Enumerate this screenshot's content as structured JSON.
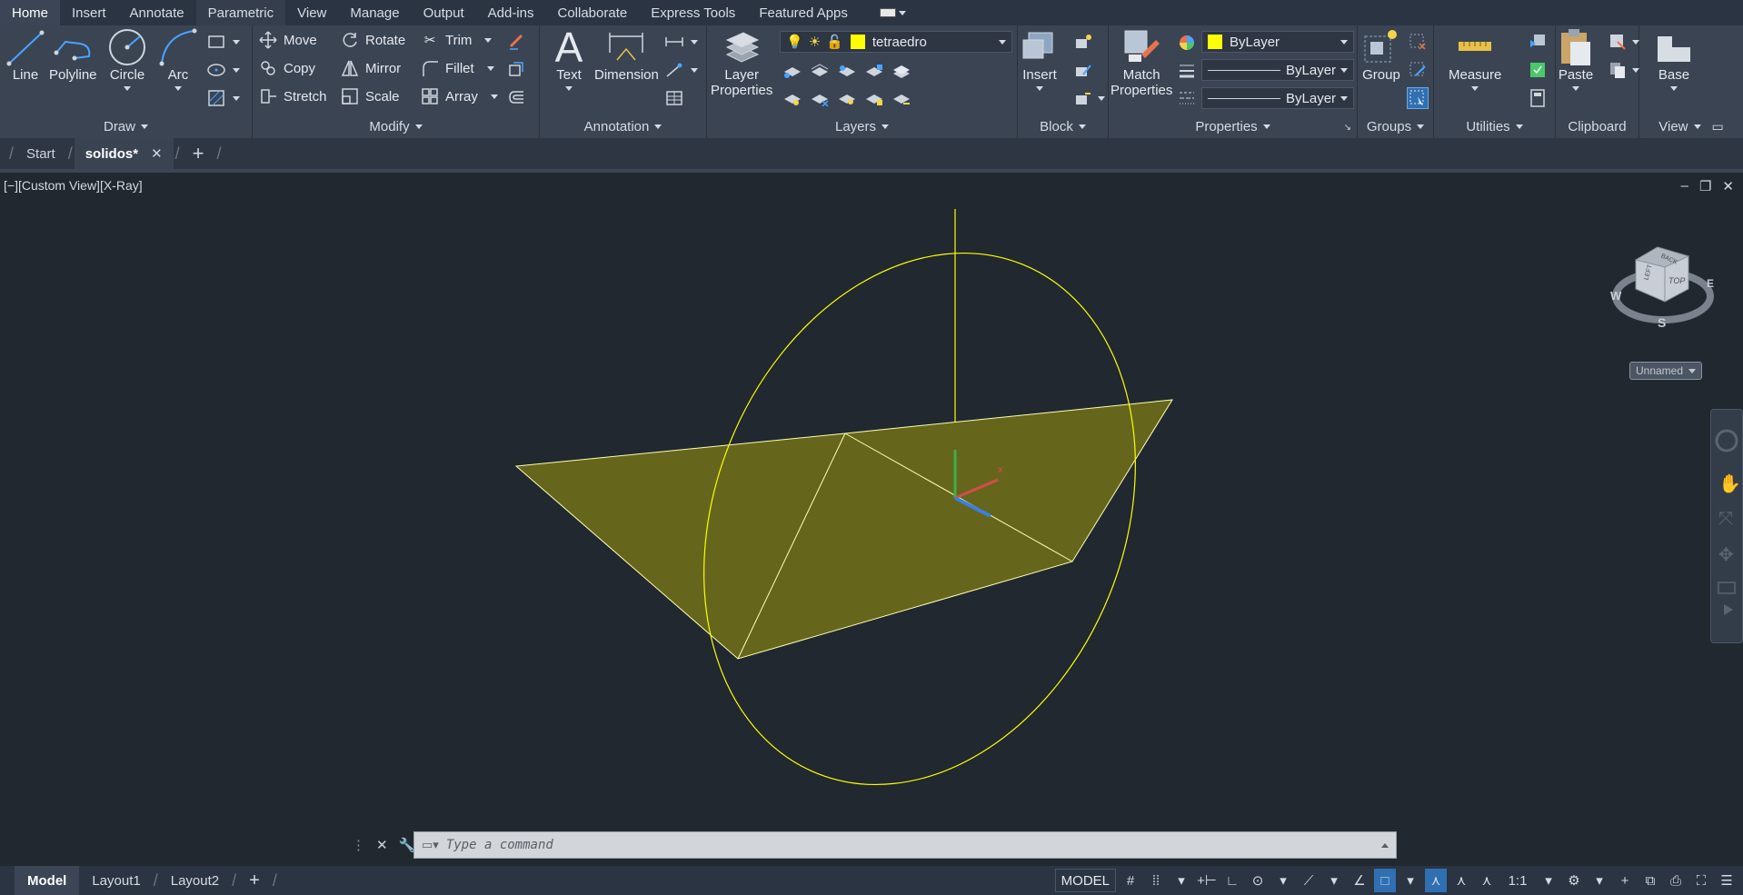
{
  "ribbon_tabs": [
    "Home",
    "Insert",
    "Annotate",
    "Parametric",
    "View",
    "Manage",
    "Output",
    "Add-ins",
    "Collaborate",
    "Express Tools",
    "Featured Apps"
  ],
  "active_tab": "Home",
  "draw": {
    "title": "Draw",
    "line": "Line",
    "polyline": "Polyline",
    "circle": "Circle",
    "arc": "Arc"
  },
  "modify": {
    "title": "Modify",
    "move": "Move",
    "rotate": "Rotate",
    "trim": "Trim",
    "copy": "Copy",
    "mirror": "Mirror",
    "fillet": "Fillet",
    "stretch": "Stretch",
    "scale": "Scale",
    "array": "Array"
  },
  "annotation": {
    "title": "Annotation",
    "text": "Text",
    "dimension": "Dimension"
  },
  "layers": {
    "title": "Layers",
    "layer_properties_line1": "Layer",
    "layer_properties_line2": "Properties",
    "current_layer": "tetraedro",
    "layer_color": "#ffff00"
  },
  "block": {
    "title": "Block",
    "insert": "Insert"
  },
  "properties": {
    "title": "Properties",
    "match_line1": "Match",
    "match_line2": "Properties",
    "color": "ByLayer",
    "lineweight": "ByLayer",
    "linetype": "ByLayer"
  },
  "groups": {
    "title": "Groups",
    "group": "Group"
  },
  "utilities": {
    "title": "Utilities",
    "measure": "Measure"
  },
  "clipboard": {
    "title": "Clipboard",
    "paste": "Paste"
  },
  "view": {
    "title": "View",
    "base": "Base"
  },
  "doc_tabs": {
    "start": "Start",
    "active": "solidos*"
  },
  "viewport": {
    "label": "[−][Custom View][X-Ray]",
    "viewcube_top": "TOP",
    "viewcube_left": "LEFT",
    "viewcube_back": "BACK",
    "compass_w": "W",
    "compass_e": "E",
    "compass_s": "S",
    "ucs_name": "Unnamed"
  },
  "command": {
    "placeholder": "Type a command"
  },
  "status": {
    "layouts": [
      "Model",
      "Layout1",
      "Layout2"
    ],
    "model_button": "MODEL",
    "scale": "1:1"
  },
  "colors": {
    "accent": "#2f6fb2",
    "geometry": "#ffff00",
    "face_fill": "#6b6b1b",
    "background": "#212830"
  }
}
